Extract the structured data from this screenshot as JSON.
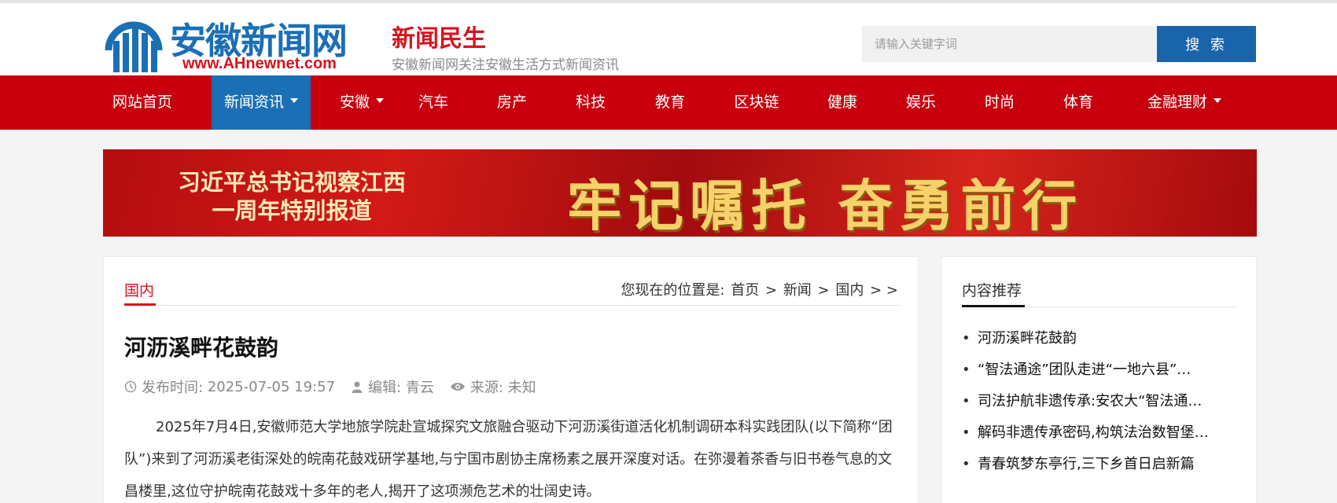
{
  "header": {
    "logo_text": "安徽新闻网",
    "logo_url": "www.AHnewnet.com",
    "channel_title": "新闻民生",
    "channel_subtitle": "安徽新闻网关注安徽生活方式新闻资讯"
  },
  "search": {
    "placeholder": "请输入关键字词",
    "button_label": "搜 索"
  },
  "nav": {
    "items": [
      {
        "label": "网站首页",
        "dropdown": false,
        "active": false
      },
      {
        "label": "新闻资讯",
        "dropdown": true,
        "active": true
      },
      {
        "label": "安徽",
        "dropdown": true,
        "active": false
      },
      {
        "label": "汽车",
        "dropdown": false,
        "active": false
      },
      {
        "label": "房产",
        "dropdown": false,
        "active": false
      },
      {
        "label": "科技",
        "dropdown": false,
        "active": false
      },
      {
        "label": "教育",
        "dropdown": false,
        "active": false
      },
      {
        "label": "区块链",
        "dropdown": false,
        "active": false
      },
      {
        "label": "健康",
        "dropdown": false,
        "active": false
      },
      {
        "label": "娱乐",
        "dropdown": false,
        "active": false
      },
      {
        "label": "时尚",
        "dropdown": false,
        "active": false
      },
      {
        "label": "体育",
        "dropdown": false,
        "active": false
      },
      {
        "label": "金融理财",
        "dropdown": true,
        "active": false
      }
    ]
  },
  "banner": {
    "left_line1": "习近平总书记视察江西",
    "left_line2": "一周年特别报道",
    "right_text": "牢记嘱托 奋勇前行"
  },
  "main": {
    "tab_label": "国内",
    "breadcrumb": {
      "prefix": "您现在的位置是:",
      "items": [
        "首页",
        "新闻",
        "国内"
      ],
      "separator": ">",
      "trailing": "> >"
    },
    "article": {
      "title": "河沥溪畔花鼓韵",
      "publish_label": "发布时间:",
      "publish_time": "2025-07-05 19:57",
      "editor_label": "编辑:",
      "editor": "青云",
      "source_label": "来源:",
      "source": "未知",
      "body": "2025年7月4日,安徽师范大学地旅学院赴宣城探究文旅融合驱动下河沥溪街道活化机制调研本科实践团队(以下简称“团队”)来到了河沥溪老街深处的皖南花鼓戏研学基地,与宁国市剧协主席杨素之展开深度对话。在弥漫着茶香与旧书卷气息的文昌楼里,这位守护皖南花鼓戏十多年的老人,揭开了这项濒危艺术的壮阔史诗。"
    }
  },
  "sidebar": {
    "title": "内容推荐",
    "items": [
      "河沥溪畔花鼓韵",
      "“智法通途”团队走进“一地六县”…",
      "司法护航非遗传承:安农大“智法通…",
      "解码非遗传承密码,构筑法治数智堡…",
      "青春筑梦东亭行,三下乡首日启新篇"
    ]
  },
  "colors": {
    "brand_blue": "#1a6fb5",
    "brand_red": "#d8121e",
    "nav_red": "#c8000d",
    "search_blue": "#1a64ab"
  }
}
